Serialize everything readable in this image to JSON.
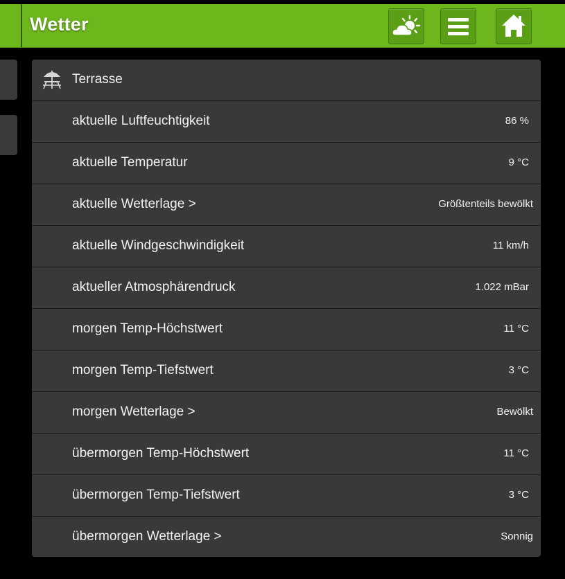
{
  "header": {
    "title": "Wetter",
    "icons": {
      "weather": "partly-cloudy-icon",
      "menu": "hamburger-menu-icon",
      "home": "home-icon"
    }
  },
  "colors": {
    "header_green": "#6cb71c",
    "button_green": "#5a9f16",
    "panel": "#393939",
    "background": "#000000",
    "text": "#f2f2f2"
  },
  "panel": {
    "title": "Terrasse",
    "title_icon": "patio-umbrella-table-icon",
    "rows": [
      {
        "label": "aktuelle Luftfeuchtigkeit",
        "value": "86 %"
      },
      {
        "label": "aktuelle Temperatur",
        "value": "9 °C"
      },
      {
        "label": "aktuelle Wetterlage >",
        "value": "Größtenteils bewölkt"
      },
      {
        "label": "aktuelle Windgeschwindigkeit",
        "value": "11 km/h"
      },
      {
        "label": "aktueller Atmosphärendruck",
        "value": "1.022 mBar"
      },
      {
        "label": "morgen Temp-Höchstwert",
        "value": "11 °C"
      },
      {
        "label": "morgen Temp-Tiefstwert",
        "value": "3 °C"
      },
      {
        "label": "morgen Wetterlage >",
        "value": "Bewölkt"
      },
      {
        "label": "übermorgen Temp-Höchstwert",
        "value": "11 °C"
      },
      {
        "label": "übermorgen Temp-Tiefstwert",
        "value": "3 °C"
      },
      {
        "label": "übermorgen Wetterlage >",
        "value": "Sonnig"
      }
    ]
  }
}
